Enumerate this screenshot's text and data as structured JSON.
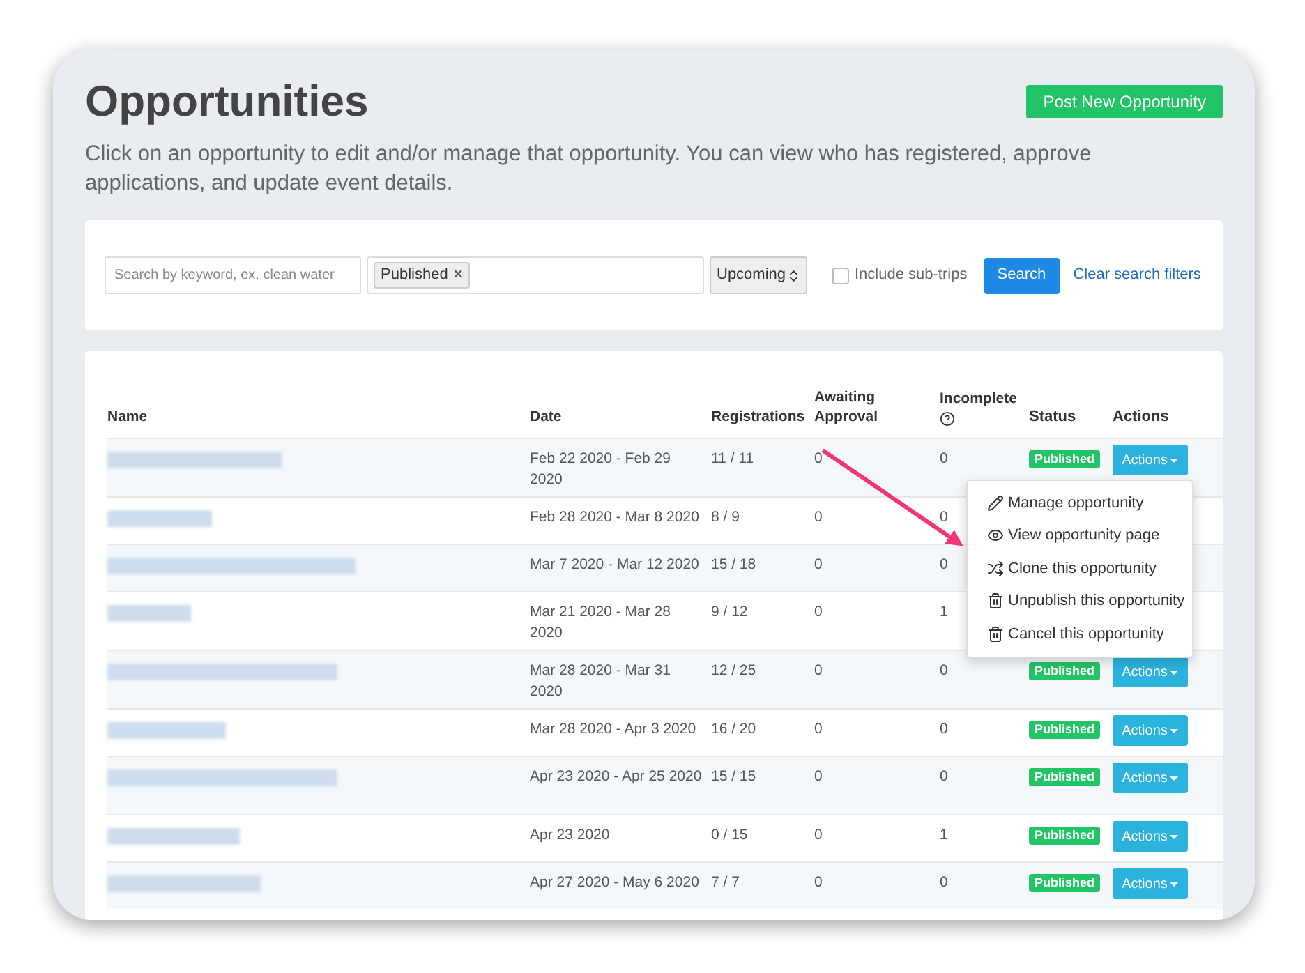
{
  "page": {
    "title": "Opportunities",
    "post_button": "Post New Opportunity",
    "description": "Click on an opportunity to edit and/or manage that opportunity. You can view who has registered, approve applications, and update event details."
  },
  "filters": {
    "search": {
      "placeholder": "Search by keyword, ex. clean water"
    },
    "tags": [
      {
        "label": "Published",
        "remove": "×"
      }
    ],
    "timeframe": "Upcoming",
    "include_sub_trips": {
      "label": "Include sub-trips",
      "checked": false
    },
    "search_button": "Search",
    "clear_link": "Clear search filters"
  },
  "table": {
    "columns": [
      "Name",
      "Date",
      "Registrations",
      "Awaiting Approval",
      "Incomplete"
    ],
    "columns_after": [
      "Status",
      "Actions"
    ],
    "rows": [
      {
        "date": "Feb 22 2020 - Feb 29 2020",
        "registrations": "11 / 11",
        "awaiting": "0",
        "incomplete": "0",
        "status": "Published",
        "actions": "Actions"
      },
      {
        "date": "Feb 28 2020 - Mar 8 2020",
        "registrations": "8 / 9",
        "awaiting": "0",
        "incomplete": "0"
      },
      {
        "date": "Mar 7 2020 - Mar 12 2020",
        "registrations": "15 / 18",
        "awaiting": "0",
        "incomplete": "0"
      },
      {
        "date": "Mar 21 2020 - Mar 28 2020",
        "registrations": "9 / 12",
        "awaiting": "0",
        "incomplete": "1"
      },
      {
        "date": "Mar 28 2020 - Mar 31 2020",
        "registrations": "12 / 25",
        "awaiting": "0",
        "incomplete": "0",
        "status": "Published",
        "actions": "Actions"
      },
      {
        "date": "Mar 28 2020 - Apr 3 2020",
        "registrations": "16 / 20",
        "awaiting": "0",
        "incomplete": "0",
        "status": "Published",
        "actions": "Actions"
      },
      {
        "date": "Apr 23 2020 - Apr 25 2020",
        "registrations": "15 / 15",
        "awaiting": "0",
        "incomplete": "0",
        "status": "Published",
        "actions": "Actions"
      },
      {
        "date": "Apr 23 2020",
        "registrations": "0 / 15",
        "awaiting": "0",
        "incomplete": "1",
        "status": "Published",
        "actions": "Actions"
      },
      {
        "date": "Apr 27 2020 - May 6 2020",
        "registrations": "7 / 7",
        "awaiting": "0",
        "incomplete": "0",
        "status": "Published",
        "actions": "Actions"
      }
    ]
  },
  "actions_menu": {
    "items": [
      {
        "kind": "pencil",
        "label": "Manage opportunity"
      },
      {
        "kind": "eye",
        "label": "View opportunity page"
      },
      {
        "kind": "shuffle",
        "label": "Clone this opportunity"
      },
      {
        "kind": "trash",
        "label": "Unpublish this opportunity"
      },
      {
        "kind": "trash",
        "label": "Cancel this opportunity"
      }
    ]
  }
}
